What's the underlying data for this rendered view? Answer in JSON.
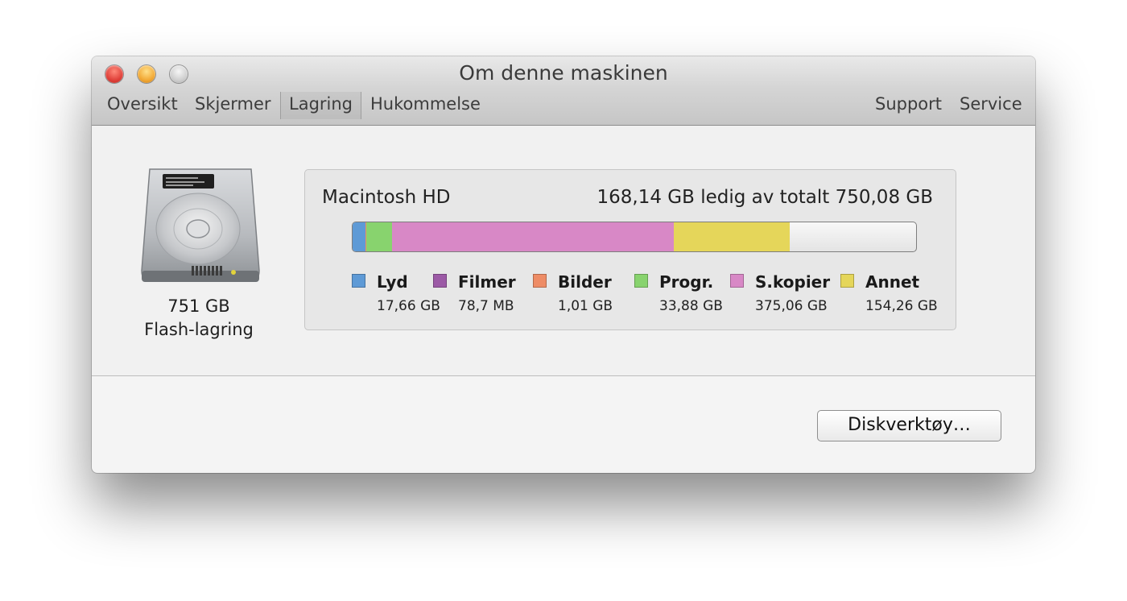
{
  "window": {
    "title": "Om denne maskinen"
  },
  "tabs": {
    "overview": "Oversikt",
    "displays": "Skjermer",
    "storage": "Lagring",
    "memory": "Hukommelse",
    "support": "Support",
    "service": "Service",
    "selected": "storage"
  },
  "drive": {
    "size": "751 GB",
    "type": "Flash-lagring",
    "icon": "hard-drive-icon"
  },
  "volume": {
    "name": "Macintosh HD",
    "free_text": "168,14 GB ledig av totalt 750,08 GB",
    "free_gb": 168.14,
    "total_gb": 750.08
  },
  "storage_breakdown": [
    {
      "label": "Lyd",
      "value": "17,66 GB",
      "gb": 17.66,
      "color": "#5e9ad6"
    },
    {
      "label": "Filmer",
      "value": "78,7 MB",
      "gb": 0.0787,
      "color": "#9c5aa6"
    },
    {
      "label": "Bilder",
      "value": "1,01 GB",
      "gb": 1.01,
      "color": "#ee8c66"
    },
    {
      "label": "Progr.",
      "value": "33,88 GB",
      "gb": 33.88,
      "color": "#88d36e"
    },
    {
      "label": "S.kopier",
      "value": "375,06 GB",
      "gb": 375.06,
      "color": "#d888c6"
    },
    {
      "label": "Annet",
      "value": "154,26 GB",
      "gb": 154.26,
      "color": "#e5d65a"
    }
  ],
  "footer": {
    "disk_utility_label": "Diskverktøy…"
  }
}
